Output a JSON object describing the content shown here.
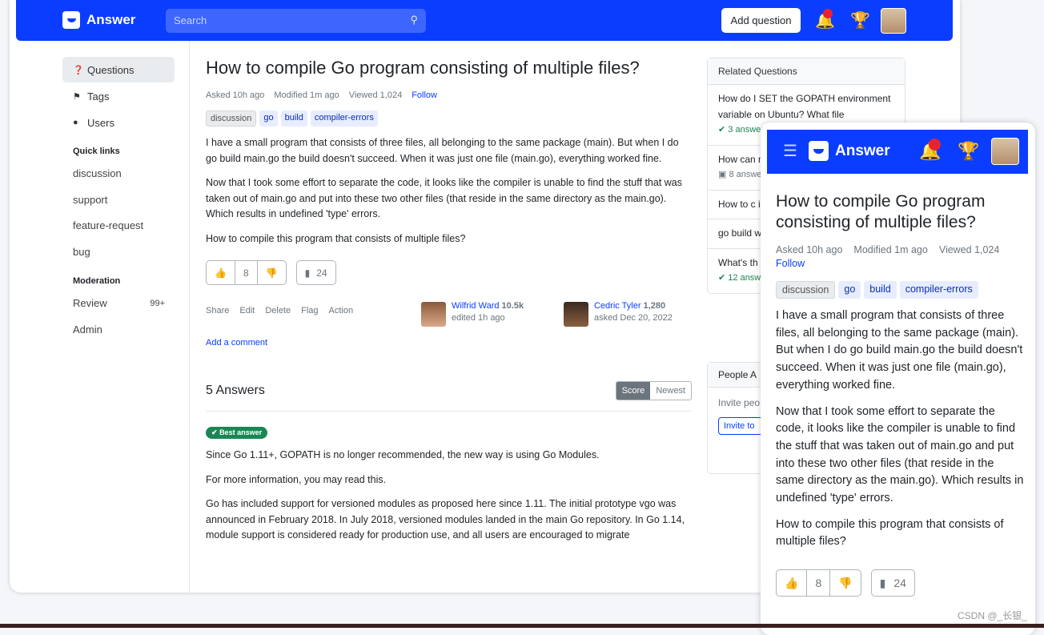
{
  "header": {
    "logo": "Answer",
    "search_placeholder": "Search",
    "add_question": "Add question"
  },
  "sidebar": {
    "items": [
      {
        "label": "Questions",
        "icon": "question-circle-icon"
      },
      {
        "label": "Tags",
        "icon": "tag-icon"
      },
      {
        "label": "Users",
        "icon": "users-icon"
      }
    ],
    "quick_links_title": "Quick links",
    "quick_links": [
      "discussion",
      "support",
      "feature-request",
      "bug"
    ],
    "moderation_title": "Moderation",
    "moderation": [
      {
        "label": "Review",
        "badge": "99+"
      },
      {
        "label": "Admin",
        "badge": ""
      }
    ]
  },
  "question": {
    "title": "How to compile Go program consisting of multiple files?",
    "asked": "Asked 10h ago",
    "modified": "Modified 1m ago",
    "viewed": "Viewed 1,024",
    "follow": "Follow",
    "tags": [
      "discussion",
      "go",
      "build",
      "compiler-errors"
    ],
    "paragraphs": [
      "I have a small program that consists of three files, all belonging to the same package (main). But when I do go build main.go the build doesn't succeed. When it was just one file (main.go), everything worked fine.",
      "Now that I took some effort to separate the code, it looks like the compiler is unable to find the stuff that was taken out of main.go and put into these two other files (that reside in the same directory as the main.go). Which results in undefined 'type' errors.",
      "How to compile this program that consists of multiple files?"
    ],
    "votes": "8",
    "bookmarks": "24",
    "actions": [
      "Share",
      "Edit",
      "Delete",
      "Flag",
      "Action"
    ],
    "editor": {
      "name": "Wilfrid Ward",
      "rep": "10.5k",
      "note": "edited 1h ago"
    },
    "author": {
      "name": "Cedric Tyler",
      "rep": "1,280",
      "note": "asked Dec 20, 2022"
    },
    "add_comment": "Add a comment"
  },
  "answers": {
    "title": "5 Answers",
    "sort": [
      "Score",
      "Newest"
    ],
    "best_label": "Best answer",
    "paragraphs": [
      "Since Go 1.11+, GOPATH is no longer recommended, the new way is using Go Modules.",
      "For more information, you may read this.",
      "Go has included support for versioned modules as proposed here since 1.11. The initial prototype vgo was announced in February 2018. In July 2018, versioned modules landed in the main Go repository. In Go 1.14, module support is considered ready for production use, and all users are encouraged to migrate"
    ]
  },
  "related": {
    "title": "Related Questions",
    "items": [
      {
        "title": "How do I SET the GOPATH environment variable on Ubuntu? What file",
        "count": "3 answers"
      },
      {
        "title": "How can multiple f",
        "count": "8 answers"
      },
      {
        "title": "How to c in Go?",
        "count": ""
      },
      {
        "title": "go build w",
        "count": ""
      },
      {
        "title": "What's th projects",
        "count": "12 answers"
      }
    ]
  },
  "people": {
    "title": "People A",
    "text": "Invite peo know the",
    "button": "Invite to"
  },
  "watermark": "CSDN @_长银_",
  "colors": {
    "brand": "#0a3dff",
    "success": "#198754"
  }
}
